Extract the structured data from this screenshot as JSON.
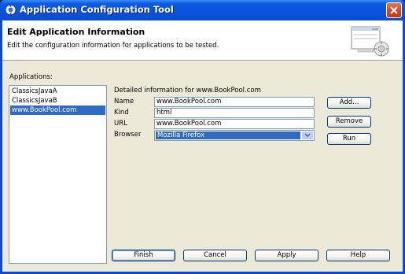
{
  "window": {
    "title": "Application Configuration Tool"
  },
  "header": {
    "title": "Edit Application Information",
    "description": "Edit the configuration information for applications to be tested."
  },
  "applications": {
    "label": "Applications:",
    "items": [
      "ClassicsJavaA",
      "ClassicsJavaB",
      "www.BookPool.com"
    ],
    "selected_index": 2
  },
  "details": {
    "heading": "Detailed information for www.BookPool.com",
    "name_label": "Name",
    "name_value": "www.BookPool.com",
    "kind_label": "Kind",
    "kind_value": "html",
    "url_label": "URL",
    "url_value": "www.BookPool.com",
    "browser_label": "Browser",
    "browser_value": "Mozilla Firefox"
  },
  "side_buttons": {
    "add": "Add...",
    "remove": "Remove",
    "run": "Run"
  },
  "bottom_buttons": {
    "finish": "Finish",
    "cancel": "Cancel",
    "apply": "Apply",
    "help": "Help"
  },
  "colors": {
    "titlebar": "#0a54dc",
    "selection": "#316ac5",
    "dialog_bg": "#ece9d8",
    "close_button": "#d04a28"
  },
  "icons": [
    "app-icon",
    "close-icon",
    "wizard-graphic-icon",
    "dropdown-arrow-icon"
  ]
}
